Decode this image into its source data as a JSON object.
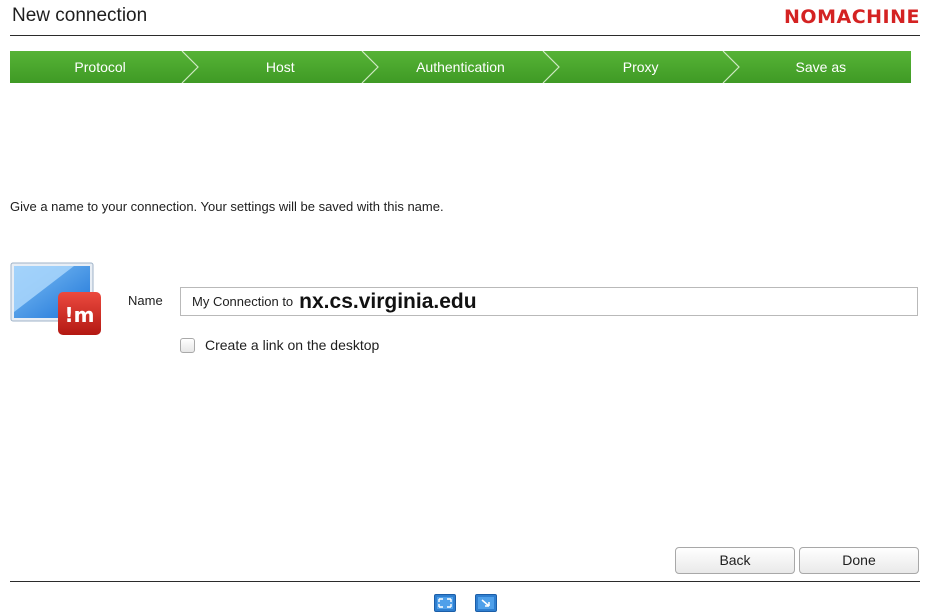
{
  "window": {
    "title": "New connection",
    "brand": "NOMACHINE",
    "brand_color": "#d42222"
  },
  "steps": {
    "accent_color": "#4aa62c",
    "active_index": 4,
    "items": [
      {
        "label": "Protocol"
      },
      {
        "label": "Host"
      },
      {
        "label": "Authentication"
      },
      {
        "label": "Proxy"
      },
      {
        "label": "Save as"
      }
    ]
  },
  "main": {
    "instruction": "Give a name to your connection. Your settings will be saved with this name.",
    "icon": "nomachine-connection-icon",
    "name_label": "Name",
    "name_value_prefix": "My Connection to",
    "name_value_host": "nx.cs.virginia.edu",
    "desktop_link_label": "Create a link on the desktop",
    "desktop_link_checked": false
  },
  "buttons": {
    "back": "Back",
    "done": "Done"
  },
  "footer": {
    "icons": [
      "fullscreen-icon",
      "resize-window-icon"
    ]
  }
}
